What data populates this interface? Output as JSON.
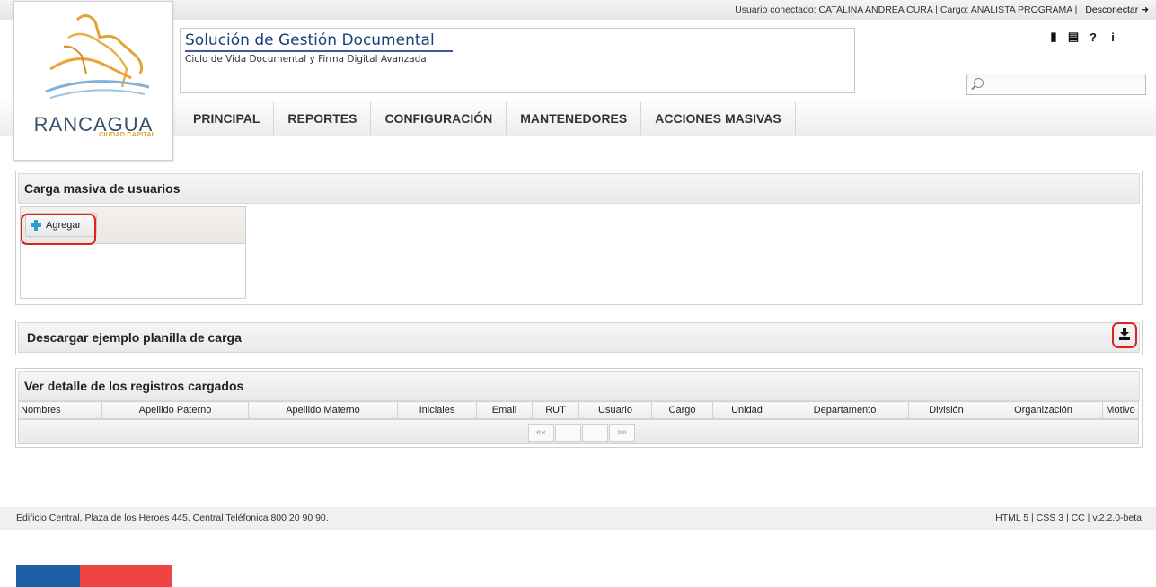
{
  "topbar": {
    "user_info": "Usuario conectado: CATALINA ANDREA CURA | Cargo: ANALISTA PROGRAMA |",
    "logout": "Desconectar"
  },
  "logo": {
    "name": "RANCAGUA",
    "subtitle": "CIUDAD CAPITAL"
  },
  "header": {
    "title": "Solución de Gestión Documental",
    "subtitle": "Ciclo de Vida Documental y Firma Digital Avanzada",
    "icons": [
      "book-icon",
      "news-icon",
      "help-icon",
      "info-icon"
    ],
    "search_placeholder": ""
  },
  "nav": {
    "items": [
      "PRINCIPAL",
      "REPORTES",
      "CONFIGURACIÓN",
      "MANTENEDORES",
      "ACCIONES MASIVAS"
    ]
  },
  "upload_panel": {
    "title": "Carga masiva de usuarios",
    "add_label": "Agregar"
  },
  "download_panel": {
    "title": "Descargar ejemplo planilla de carga"
  },
  "detail_panel": {
    "title": "Ver detalle de los registros cargados",
    "columns": [
      "Nombres",
      "Apellido Paterno",
      "Apellido Materno",
      "Iniciales",
      "Email",
      "RUT",
      "Usuario",
      "Cargo",
      "Unidad",
      "Departamento",
      "División",
      "Organización",
      "Motivo"
    ],
    "pager": [
      "««",
      "",
      "",
      "»»"
    ]
  },
  "footer": {
    "address": "Edificio Central, Plaza de los Heroes 445, Central Teléfonica 800 20 90 90.",
    "version": "HTML 5 | CSS 3 | CC | v.2.2.0-beta"
  },
  "colors": {
    "flag_blue": "#1f5fa8",
    "flag_red": "#ef4444",
    "highlight": "#dd2222"
  }
}
